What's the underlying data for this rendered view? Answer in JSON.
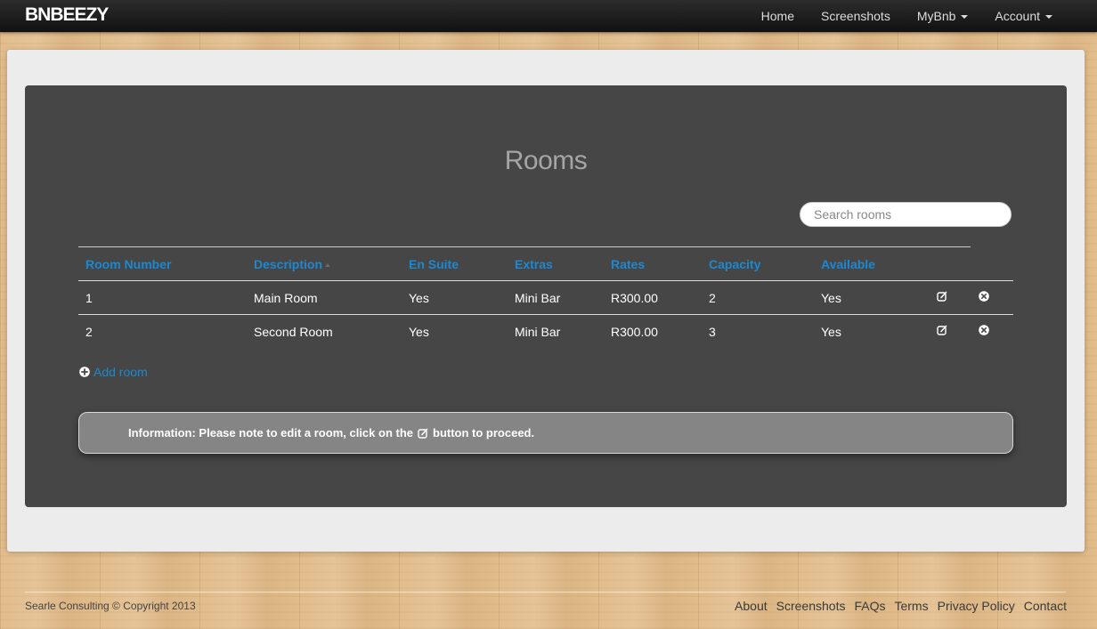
{
  "navbar": {
    "brand": "BNBEEZY",
    "items": [
      {
        "label": "Home",
        "dropdown": false
      },
      {
        "label": "Screenshots",
        "dropdown": false
      },
      {
        "label": "MyBnb",
        "dropdown": true
      },
      {
        "label": "Account",
        "dropdown": true
      }
    ]
  },
  "page": {
    "title": "Rooms",
    "search_placeholder": "Search rooms"
  },
  "table": {
    "columns": [
      "Room Number",
      "Description",
      "En Suite",
      "Extras",
      "Rates",
      "Capacity",
      "Available"
    ],
    "sorted_column": "Description",
    "rows": [
      {
        "room_number": "1",
        "description": "Main Room",
        "en_suite": "Yes",
        "extras": "Mini Bar",
        "rates": "R300.00",
        "capacity": "2",
        "available": "Yes"
      },
      {
        "room_number": "2",
        "description": "Second Room",
        "en_suite": "Yes",
        "extras": "Mini Bar",
        "rates": "R300.00",
        "capacity": "3",
        "available": "Yes"
      }
    ],
    "row_actions": [
      "edit-icon",
      "remove-icon"
    ]
  },
  "add_room": {
    "label": "Add room",
    "icon": "plus-circle-icon"
  },
  "info": {
    "prefix": "Information: Please note to edit a room, click on the",
    "suffix": "button to proceed.",
    "icon": "edit-icon"
  },
  "footer": {
    "copyright": "Searle Consulting © Copyright 2013",
    "links": [
      "About",
      "Screenshots",
      "FAQs",
      "Terms",
      "Privacy Policy",
      "Contact"
    ]
  },
  "colors": {
    "navbar": "#1a1a1a",
    "panel": "#464646",
    "link": "#1e88cf",
    "container": "#ececec",
    "info_box": "#858585"
  }
}
